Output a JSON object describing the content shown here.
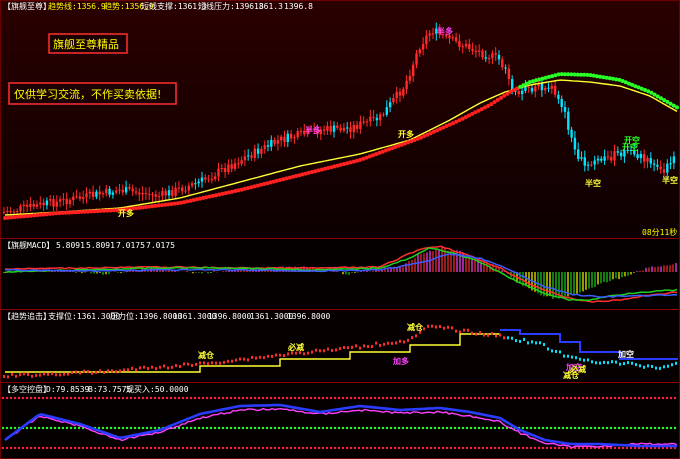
{
  "colors": {
    "bg": "#000000",
    "panel_bg_top": "#2a0000",
    "up": "#ff2a2a",
    "down": "#00e5ff",
    "support_red": "#ff2020",
    "support_green": "#27ff27",
    "avg_yellow": "#ffff33",
    "border": "#8a0000",
    "text_white": "#ffffff",
    "text_yellow": "#ffff00",
    "text_magenta": "#ff44ff",
    "blue_line": "#2a3cff",
    "macd_green": "#1fd11f",
    "macd_red": "#ff3030",
    "macd_blue": "#3a5cff",
    "ctrl_red": "#ff2040",
    "ctrl_magenta": "#ff40ff"
  },
  "panel1": {
    "title": "【旗舰至尊】",
    "items": [
      "趋势线:1356.9",
      "趋势:1356.9",
      "短线支撑:1361.3",
      "短线压力:1396.8",
      "1361.3",
      "1396.8"
    ],
    "promo": "旗舰至尊精品",
    "disclaimer": "仅供学习交流，不作买卖依据!",
    "timer": "08分11秒"
  },
  "panel2": {
    "title": "【旗舰MACD】",
    "items": [
      "5.8091",
      "5.8091",
      "7.0175",
      "7.0175"
    ]
  },
  "panel3": {
    "title": "【趋势追击】",
    "items": [
      "支撑位:1361.3000",
      "压力位:1396.8000",
      "1361.3000",
      "1396.8000",
      "1361.3000",
      "1396.8000"
    ]
  },
  "panel4": {
    "title": "【多空控盘】",
    "items": [
      "D:79.8539",
      "B:73.7575",
      "观买入:50.0000"
    ]
  },
  "chart_data": [
    {
      "type": "candlestick",
      "panel": "main",
      "series": [
        {
          "name": "趋势线",
          "value": 1356.9
        },
        {
          "name": "短线支撑",
          "value": 1361.3
        },
        {
          "name": "短线压力",
          "value": 1396.8
        }
      ],
      "annotations": [
        {
          "text": "开多",
          "color": "#ffff33"
        },
        {
          "text": "半多",
          "color": "#ff44ff"
        },
        {
          "text": "开多",
          "color": "#ffff33"
        },
        {
          "text": "半多",
          "color": "#ff44ff"
        },
        {
          "text": "开空",
          "color": "#27ff27"
        },
        {
          "text": "开空",
          "color": "#27ff27"
        },
        {
          "text": "半空",
          "color": "#ffff33"
        },
        {
          "text": "半空",
          "color": "#ffff33"
        }
      ]
    },
    {
      "type": "bar",
      "panel": "macd",
      "series": [
        {
          "name": "DIF",
          "value": 5.8091
        },
        {
          "name": "DEA",
          "value": 7.0175
        }
      ]
    },
    {
      "type": "line",
      "panel": "trend",
      "series": [
        {
          "name": "支撑位",
          "value": 1361.3
        },
        {
          "name": "压力位",
          "value": 1396.8
        }
      ],
      "annotations": [
        {
          "text": "减仓",
          "color": "#ffff33"
        },
        {
          "text": "必减",
          "color": "#ffff33"
        },
        {
          "text": "减仓",
          "color": "#ffff33"
        },
        {
          "text": "加多",
          "color": "#ff44ff"
        },
        {
          "text": "加空",
          "color": "#ff44ff"
        },
        {
          "text": "减仓",
          "color": "#ffff33"
        },
        {
          "text": "必减",
          "color": "#ffff33"
        },
        {
          "text": "加空",
          "color": "#ffffff"
        }
      ]
    },
    {
      "type": "line",
      "panel": "control",
      "series": [
        {
          "name": "D",
          "value": 79.8539
        },
        {
          "name": "B",
          "value": 73.7575
        },
        {
          "name": "观买入",
          "value": 50.0
        }
      ]
    }
  ]
}
